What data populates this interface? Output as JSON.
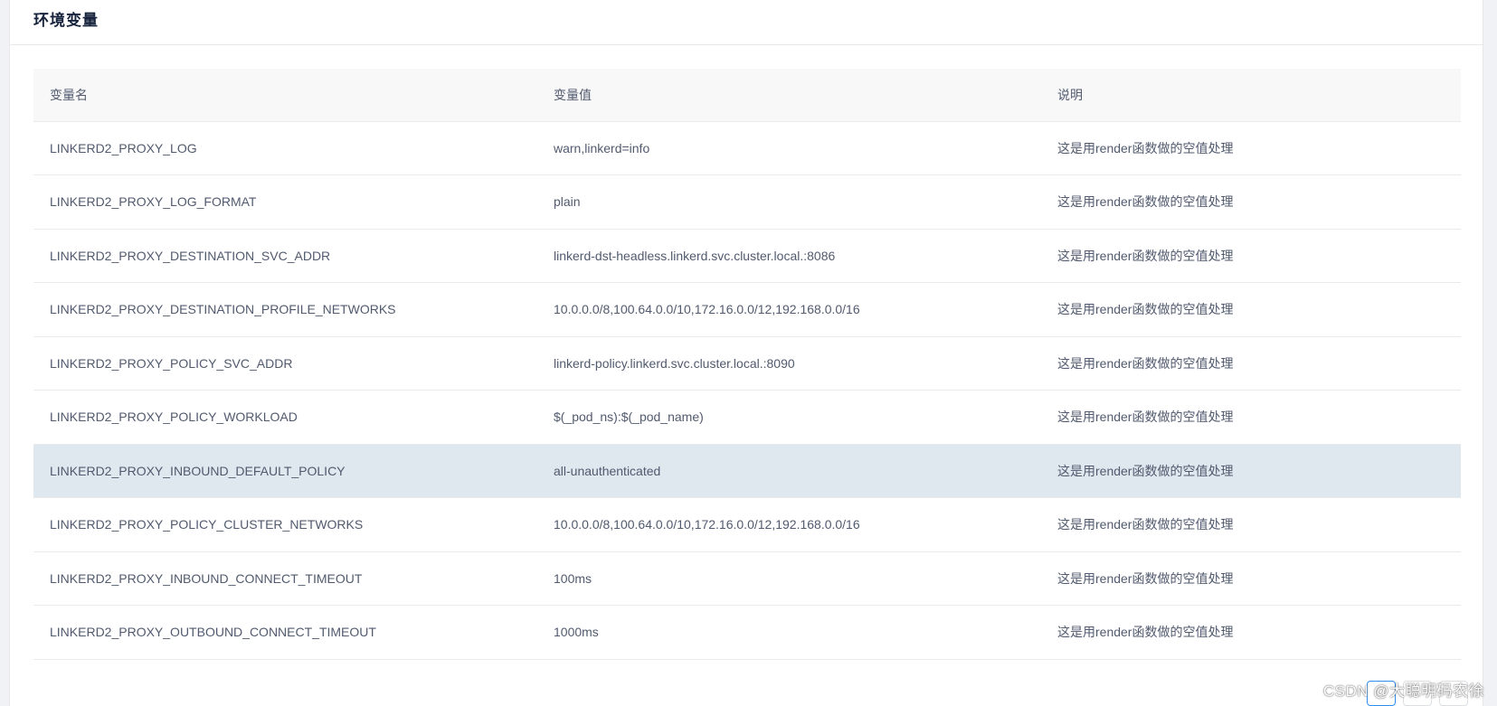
{
  "card": {
    "title": "环境变量"
  },
  "table": {
    "headers": [
      "变量名",
      "变量值",
      "说明"
    ],
    "rows": [
      {
        "name": "LINKERD2_PROXY_LOG",
        "value": "warn,linkerd=info",
        "desc": "这是用render函数做的空值处理"
      },
      {
        "name": "LINKERD2_PROXY_LOG_FORMAT",
        "value": "plain",
        "desc": "这是用render函数做的空值处理"
      },
      {
        "name": "LINKERD2_PROXY_DESTINATION_SVC_ADDR",
        "value": "linkerd-dst-headless.linkerd.svc.cluster.local.:8086",
        "desc": "这是用render函数做的空值处理"
      },
      {
        "name": "LINKERD2_PROXY_DESTINATION_PROFILE_NETWORKS",
        "value": "10.0.0.0/8,100.64.0.0/10,172.16.0.0/12,192.168.0.0/16",
        "desc": "这是用render函数做的空值处理"
      },
      {
        "name": "LINKERD2_PROXY_POLICY_SVC_ADDR",
        "value": "linkerd-policy.linkerd.svc.cluster.local.:8090",
        "desc": "这是用render函数做的空值处理"
      },
      {
        "name": "LINKERD2_PROXY_POLICY_WORKLOAD",
        "value": "$(_pod_ns):$(_pod_name)",
        "desc": "这是用render函数做的空值处理"
      },
      {
        "name": "LINKERD2_PROXY_INBOUND_DEFAULT_POLICY",
        "value": "all-unauthenticated",
        "desc": "这是用render函数做的空值处理"
      },
      {
        "name": "LINKERD2_PROXY_POLICY_CLUSTER_NETWORKS",
        "value": "10.0.0.0/8,100.64.0.0/10,172.16.0.0/12,192.168.0.0/16",
        "desc": "这是用render函数做的空值处理"
      },
      {
        "name": "LINKERD2_PROXY_INBOUND_CONNECT_TIMEOUT",
        "value": "100ms",
        "desc": "这是用render函数做的空值处理"
      },
      {
        "name": "LINKERD2_PROXY_OUTBOUND_CONNECT_TIMEOUT",
        "value": "1000ms",
        "desc": "这是用render函数做的空值处理"
      }
    ],
    "highlighted_row": 6
  },
  "watermark": "CSDN @大聪明码农徐",
  "colors": {
    "header_bg": "#f8f8f9",
    "highlight_bg": "#dfe7ef",
    "border": "#e8eaec",
    "text": "#515a6e",
    "accent": "#2d8cf0"
  }
}
